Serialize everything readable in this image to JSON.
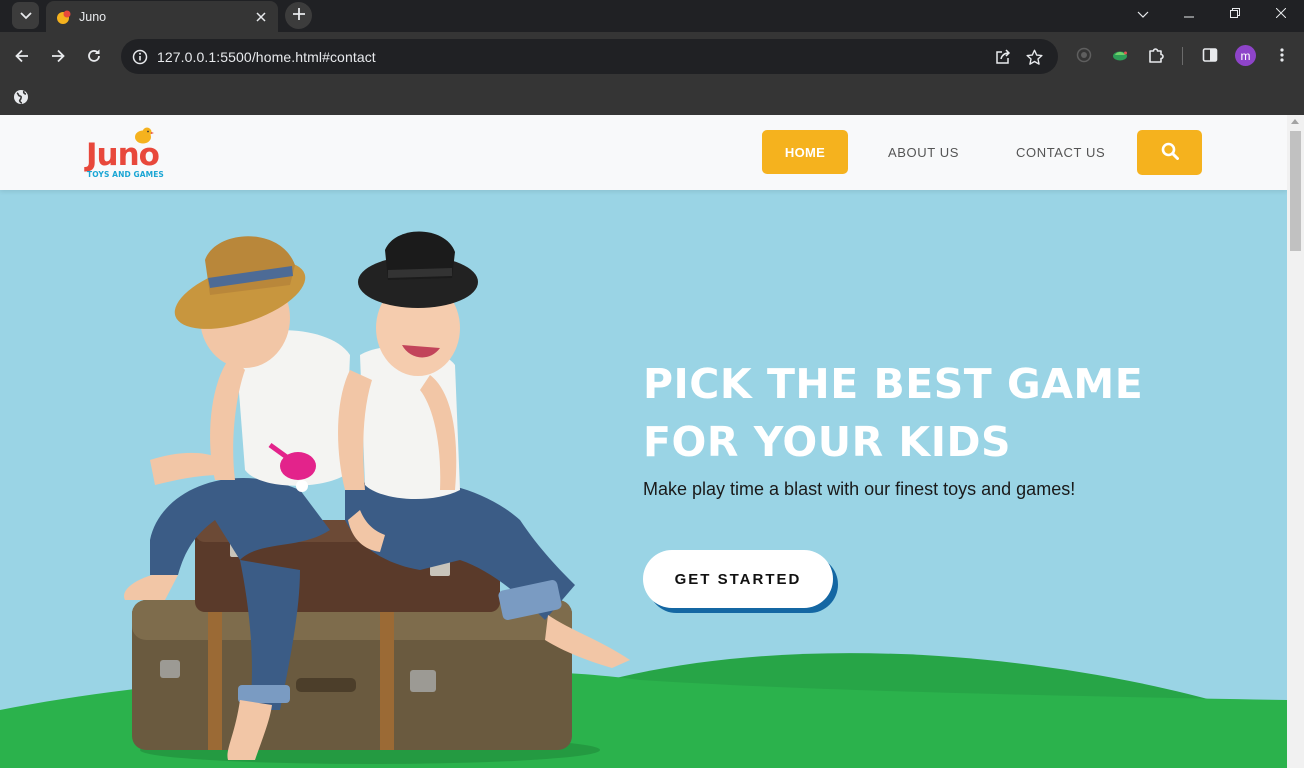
{
  "browser": {
    "tab_title": "Juno",
    "url": "127.0.0.1:5500/home.html#contact",
    "profile_initial": "m"
  },
  "nav": {
    "logo_text": "Juno",
    "logo_tagline": "TOYS AND GAMES",
    "items": [
      {
        "label": "HOME",
        "active": true
      },
      {
        "label": "ABOUT US",
        "active": false
      },
      {
        "label": "CONTACT US",
        "active": false
      }
    ]
  },
  "hero": {
    "title_line1": "PICK THE BEST GAME",
    "title_line2": "FOR YOUR KIDS",
    "subtitle": "Make play time a blast with our finest toys and games!",
    "cta_label": "GET STARTED"
  },
  "colors": {
    "accent": "#f5b21e",
    "sky": "#9ad4e5",
    "grass": "#2bb24c",
    "logo_red": "#e8483b",
    "logo_blue": "#1aa6d4",
    "cta_shadow": "#1467a3"
  }
}
